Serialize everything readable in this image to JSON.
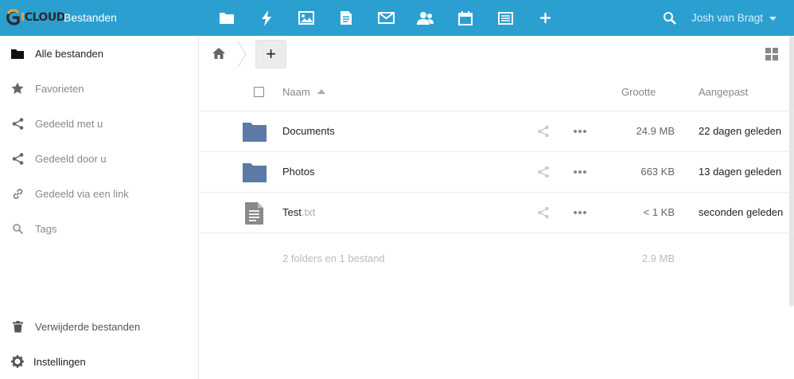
{
  "header": {
    "logo": {
      "g": "G",
      "text_hi": "I",
      "text": "CLOUD"
    },
    "app_name": "Bestanden",
    "apps": [
      {
        "icon": "folder-icon"
      },
      {
        "icon": "lightning-icon"
      },
      {
        "icon": "image-icon"
      },
      {
        "icon": "document-icon"
      },
      {
        "icon": "mail-icon"
      },
      {
        "icon": "contacts-icon"
      },
      {
        "icon": "calendar-icon"
      },
      {
        "icon": "notes-icon"
      },
      {
        "icon": "plus-icon"
      }
    ],
    "user_name": "Josh van Bragt",
    "accent": "#2c9fd1"
  },
  "sidebar": {
    "items": [
      {
        "label": "Alle bestanden",
        "icon": "folder-icon"
      },
      {
        "label": "Favorieten",
        "icon": "star-icon"
      },
      {
        "label": "Gedeeld met u",
        "icon": "share-icon"
      },
      {
        "label": "Gedeeld door u",
        "icon": "share-icon"
      },
      {
        "label": "Gedeeld via een link",
        "icon": "link-icon"
      },
      {
        "label": "Tags",
        "icon": "search-icon"
      }
    ],
    "trash_label": "Verwijderde bestanden",
    "settings_label": "Instellingen"
  },
  "toolbar": {
    "new_label": "+"
  },
  "table": {
    "columns": {
      "name": "Naam",
      "size": "Grootte",
      "modified": "Aangepast"
    },
    "rows": [
      {
        "name": "Documents",
        "ext": "",
        "type": "folder",
        "size": "24.9 MB",
        "modified": "22 dagen geleden"
      },
      {
        "name": "Photos",
        "ext": "",
        "type": "folder",
        "size": "663 KB",
        "modified": "13 dagen geleden"
      },
      {
        "name": "Test",
        "ext": ".txt",
        "type": "file",
        "size": "< 1 KB",
        "modified": "seconden geleden"
      }
    ],
    "summary": "2 folders en 1 bestand",
    "summary_size": "2.9 MB"
  }
}
